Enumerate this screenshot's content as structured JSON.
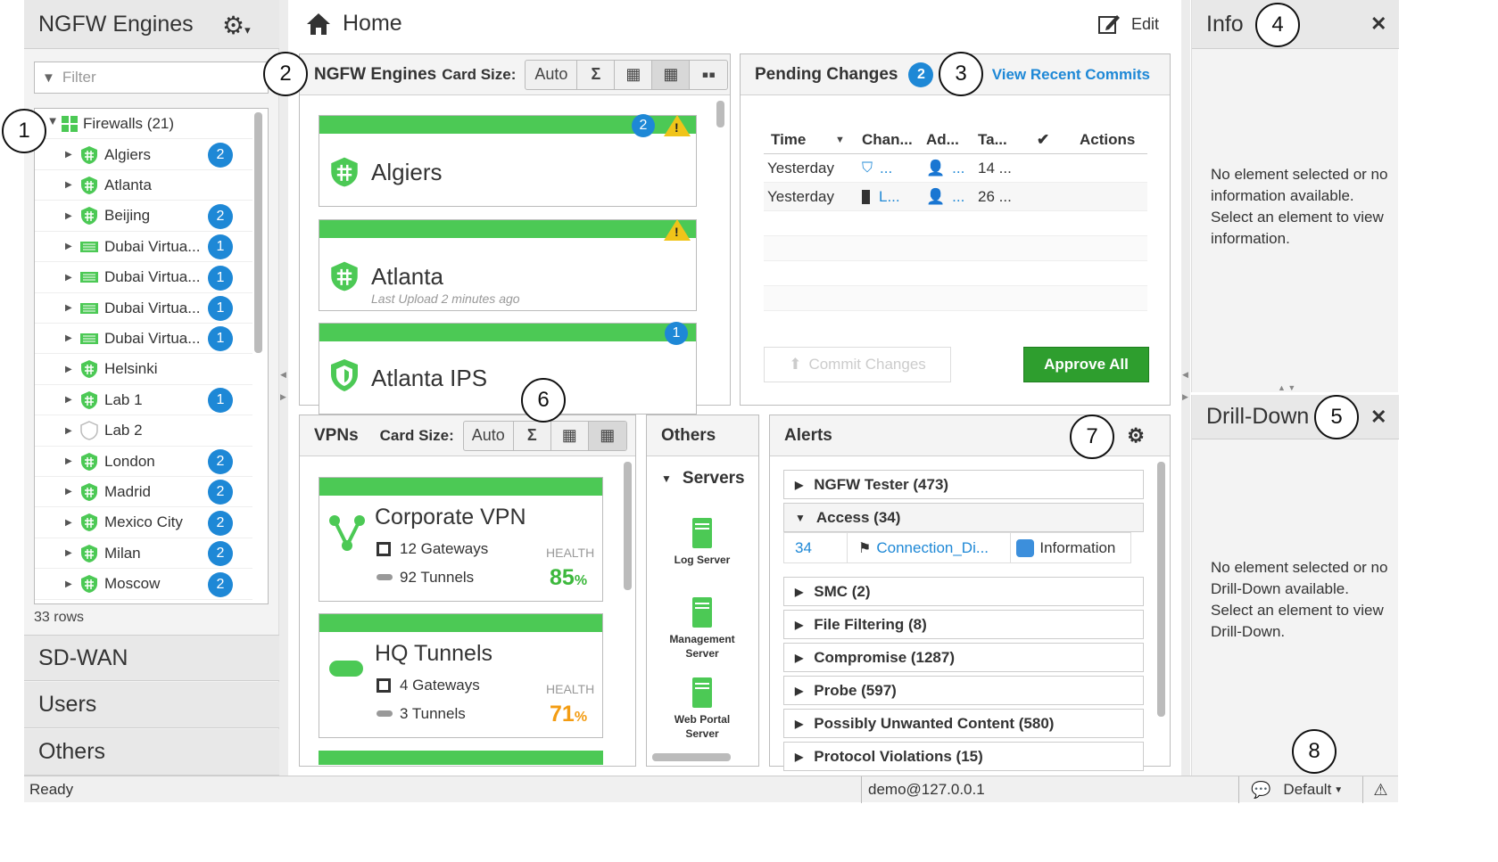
{
  "left": {
    "title": "NGFW Engines",
    "filter_placeholder": "Filter",
    "root": "Firewalls (21)",
    "items": [
      {
        "label": "Algiers",
        "badge": "2"
      },
      {
        "label": "Atlanta",
        "badge": ""
      },
      {
        "label": "Beijing",
        "badge": "2"
      },
      {
        "label": "Dubai Virtua...",
        "badge": "1"
      },
      {
        "label": "Dubai Virtua...",
        "badge": "1"
      },
      {
        "label": "Dubai Virtua...",
        "badge": "1"
      },
      {
        "label": "Dubai Virtua...",
        "badge": "1"
      },
      {
        "label": "Helsinki",
        "badge": ""
      },
      {
        "label": "Lab 1",
        "badge": "1"
      },
      {
        "label": "Lab 2",
        "badge": ""
      },
      {
        "label": "London",
        "badge": "2"
      },
      {
        "label": "Madrid",
        "badge": "2"
      },
      {
        "label": "Mexico City",
        "badge": "2"
      },
      {
        "label": "Milan",
        "badge": "2"
      },
      {
        "label": "Moscow",
        "badge": "2"
      }
    ],
    "row_count": "33 rows",
    "sections": [
      "SD-WAN",
      "Users",
      "Others"
    ]
  },
  "header": {
    "home": "Home",
    "edit": "Edit"
  },
  "engines": {
    "title": "NGFW Engines",
    "card_size_label": "Card Size:",
    "auto": "Auto",
    "sigma": "Σ",
    "cards": [
      {
        "name": "Algiers",
        "badge": "2",
        "sub": ""
      },
      {
        "name": "Atlanta",
        "badge": "",
        "sub": "Last Upload 2 minutes ago"
      },
      {
        "name": "Atlanta IPS",
        "badge": "1",
        "sub": ""
      }
    ]
  },
  "pending": {
    "title": "Pending Changes",
    "count": "2",
    "link": "View Recent Commits",
    "columns": [
      "Time",
      "Chan...",
      "Ad...",
      "Ta...",
      "✔",
      "Actions"
    ],
    "rows": [
      {
        "time": "Yesterday",
        "change": "...",
        "admin": "...",
        "target": "14 ..."
      },
      {
        "time": "Yesterday",
        "change": "L...",
        "admin": "...",
        "target": "26 ..."
      }
    ],
    "commit": "Commit Changes",
    "approve": "Approve All"
  },
  "vpns": {
    "title": "VPNs",
    "card_size_label": "Card Size:",
    "auto": "Auto",
    "sigma": "Σ",
    "cards": [
      {
        "name": "Corporate VPN",
        "gateways": "12 Gateways",
        "tunnels": "92 Tunnels",
        "health_label": "HEALTH",
        "health": "85",
        "unit": "%"
      },
      {
        "name": "HQ Tunnels",
        "gateways": "4 Gateways",
        "tunnels": "3 Tunnels",
        "health_label": "HEALTH",
        "health": "71",
        "unit": "%"
      }
    ]
  },
  "others": {
    "title": "Others",
    "group": "Servers",
    "servers": [
      {
        "line1": "Log Server",
        "line2": ""
      },
      {
        "line1": "Management",
        "line2": "Server"
      },
      {
        "line1": "Web Portal",
        "line2": "Server"
      }
    ]
  },
  "alerts": {
    "title": "Alerts",
    "groups": [
      "NGFW Tester (473)",
      "Access (34)",
      "SMC (2)",
      "File Filtering (8)",
      "Compromise (1287)",
      "Probe (597)",
      "Possibly Unwanted Content (580)",
      "Protocol Violations (15)"
    ],
    "access_row": {
      "count": "34",
      "name": "Connection_Di...",
      "severity": "Information"
    }
  },
  "info": {
    "title": "Info",
    "message": "No element selected or no information available. Select an element to view information."
  },
  "drill": {
    "title": "Drill-Down",
    "message": "No element selected or no Drill-Down available. Select an element to view Drill-Down."
  },
  "status": {
    "ready": "Ready",
    "user": "demo@127.0.0.1",
    "profile": "Default"
  },
  "callouts": [
    "1",
    "2",
    "3",
    "4",
    "5",
    "6",
    "7",
    "8"
  ],
  "colors": {
    "green": "#4cc955",
    "blue": "#1e88d6",
    "link": "#1e88d6",
    "approve": "#2e9e2e",
    "health_good": "#3db83d",
    "health_warn": "#f39c12"
  }
}
